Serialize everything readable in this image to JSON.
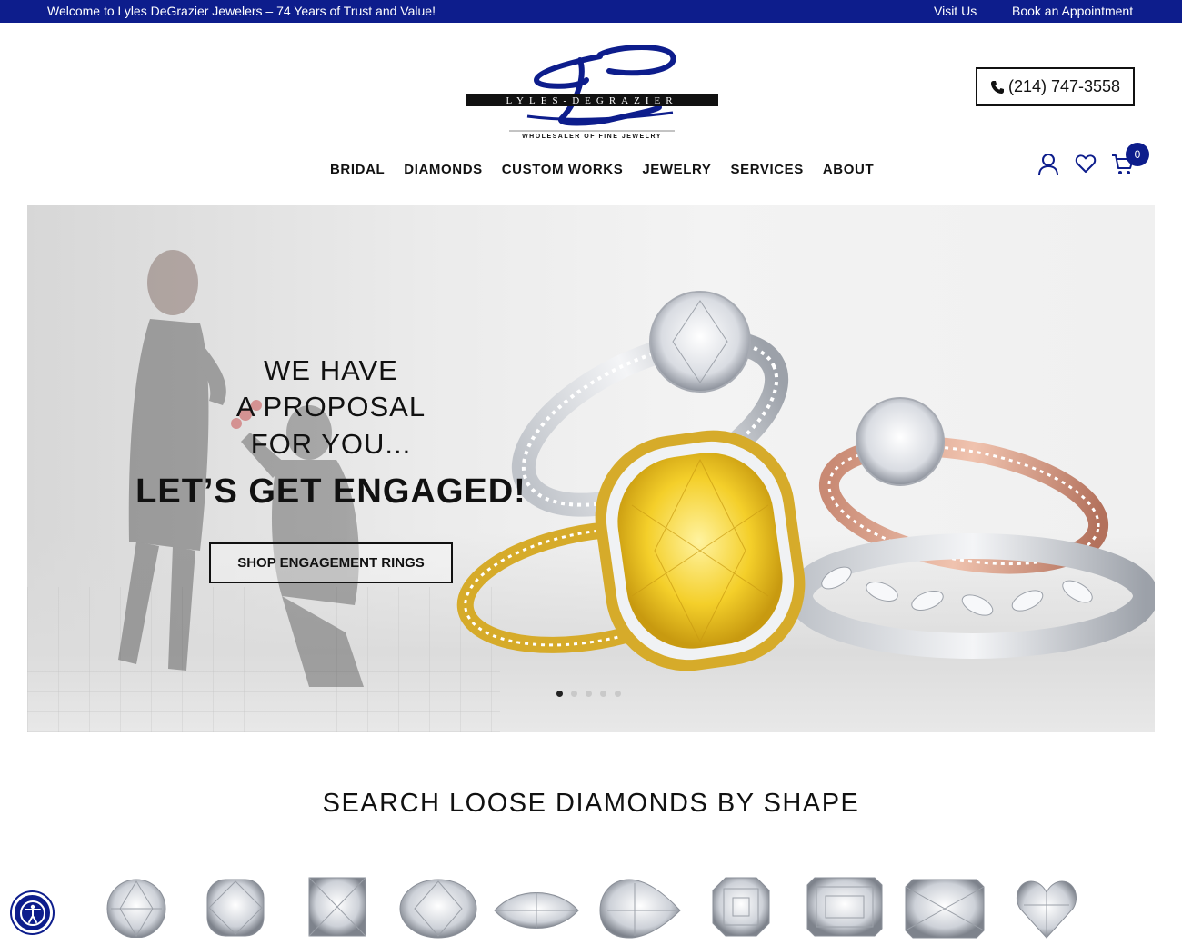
{
  "topbar": {
    "welcome": "Welcome to Lyles DeGrazier Jewelers – 74 Years of Trust and Value!",
    "visit_us": "Visit Us",
    "book_appointment": "Book an Appointment"
  },
  "logo": {
    "name": "LYLES-DEGRAZIER",
    "tagline": "WHOLESALER OF FINE JEWELRY"
  },
  "phone": "(214) 747-3558",
  "nav": [
    "BRIDAL",
    "DIAMONDS",
    "CUSTOM WORKS",
    "JEWELRY",
    "SERVICES",
    "ABOUT"
  ],
  "icons": {
    "account": "account-icon",
    "wishlist": "heart-icon",
    "cart": "cart-icon"
  },
  "cart_count": "0",
  "hero": {
    "line1": "WE HAVE",
    "line2": "A PROPOSAL",
    "line3": "FOR YOU...",
    "headline": "LET’S GET ENGAGED!",
    "button": "SHOP ENGAGEMENT RINGS",
    "slide_count": 5,
    "active_slide": 1
  },
  "section": {
    "title": "SEARCH LOOSE DIAMONDS BY SHAPE"
  },
  "shapes": [
    "round",
    "cushion",
    "princess",
    "oval",
    "marquise",
    "pear",
    "asscher",
    "emerald",
    "radiant",
    "heart"
  ],
  "colors": {
    "brand_navy": "#0d1d8c",
    "text": "#111111"
  }
}
